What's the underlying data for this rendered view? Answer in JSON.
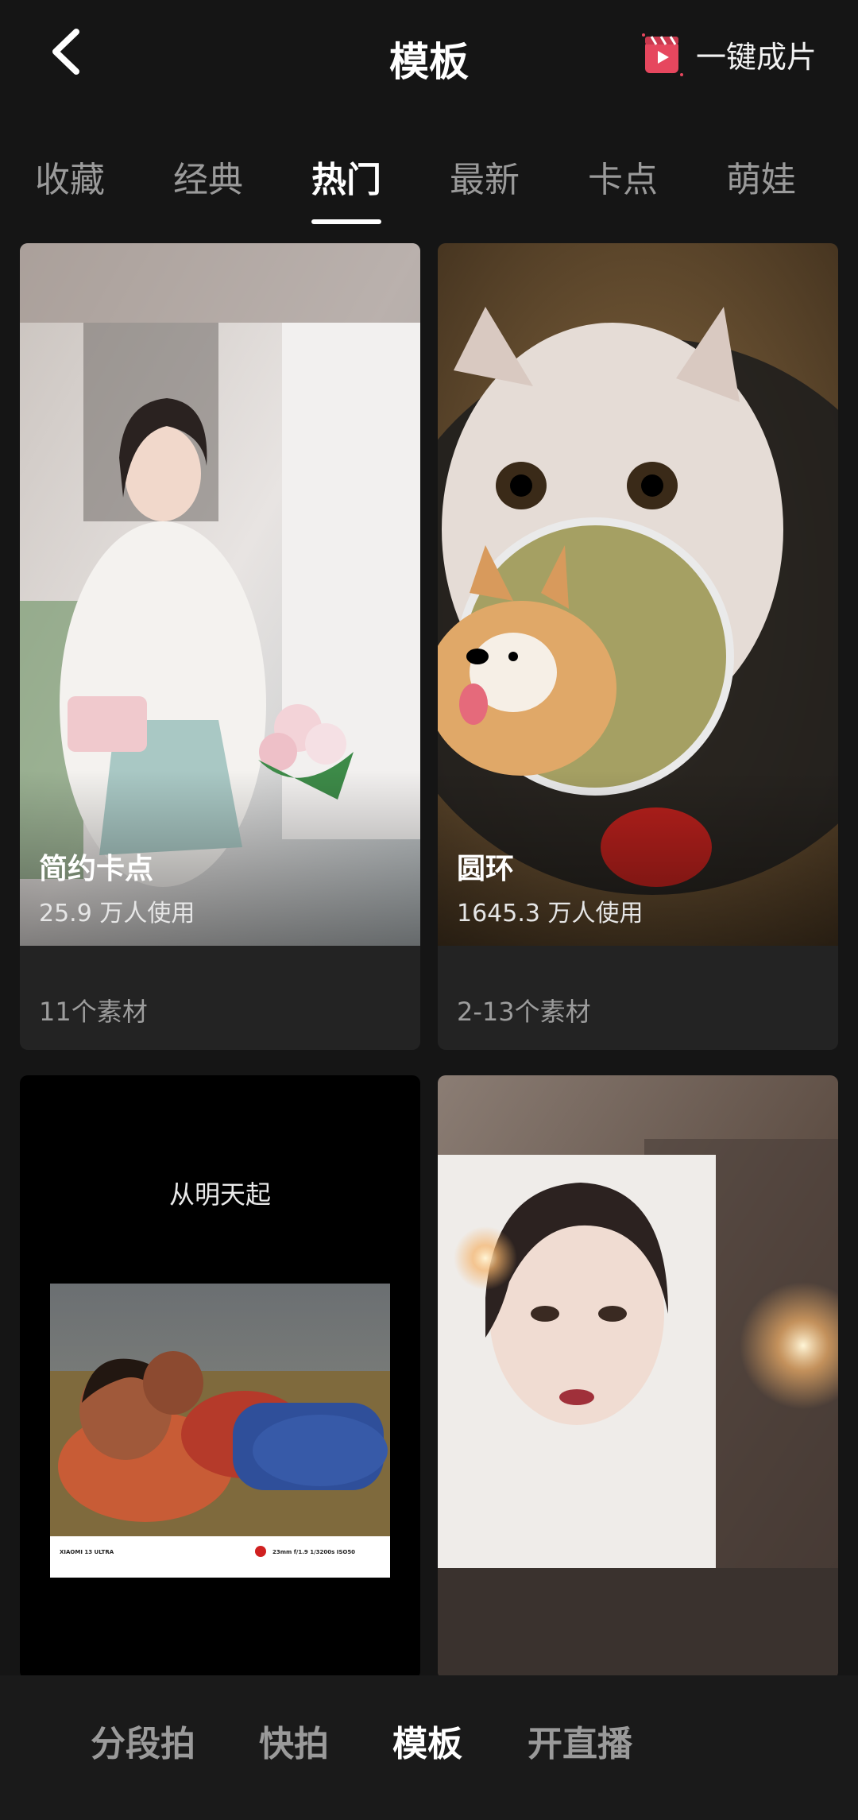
{
  "header": {
    "title": "模板",
    "one_click_label": "一键成片"
  },
  "tabs": [
    {
      "label": "收藏"
    },
    {
      "label": "经典"
    },
    {
      "label": "热门",
      "active": true
    },
    {
      "label": "最新"
    },
    {
      "label": "卡点"
    },
    {
      "label": "萌娃"
    }
  ],
  "cards": [
    {
      "title": "简约卡点",
      "usage": "25.9 万人使用",
      "materials": "11个素材"
    },
    {
      "title": "圆环",
      "usage": "1645.3 万人使用",
      "materials": "2-13个素材"
    },
    {
      "overlay_text": "从明天起",
      "photo_caption_left": "XIAOMI 13 ULTRA",
      "photo_caption_right": "23mm f/1.9 1/3200s ISO50"
    },
    {}
  ],
  "bottom_nav": [
    {
      "label": "分段拍"
    },
    {
      "label": "快拍"
    },
    {
      "label": "模板",
      "active": true
    },
    {
      "label": "开直播"
    }
  ],
  "colors": {
    "background": "#151515",
    "accent_icon": "#e6475e"
  }
}
